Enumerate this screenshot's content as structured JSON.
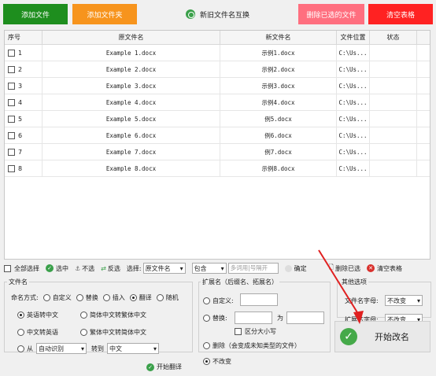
{
  "toolbar": {
    "add_file": "添加文件",
    "add_folder": "添加文件夹",
    "swap_names": "新旧文件名互换",
    "delete_selected_files": "删除已选的文件",
    "clear_table": "清空表格"
  },
  "colors": {
    "add_file_bg": "#1e8e1e",
    "add_folder_bg": "#f7941d",
    "delete_bg": "#ff6f7f",
    "clear_bg": "#ff2222"
  },
  "table": {
    "headers": [
      "序号",
      "原文件名",
      "新文件名",
      "文件位置",
      "状态"
    ],
    "rows": [
      {
        "idx": "1",
        "orig": "Example 1.docx",
        "new": "示例1.docx",
        "loc": "C:\\Us...",
        "status": ""
      },
      {
        "idx": "2",
        "orig": "Example 2.docx",
        "new": "示例2.docx",
        "loc": "C:\\Us...",
        "status": ""
      },
      {
        "idx": "3",
        "orig": "Example 3.docx",
        "new": "示例3.docx",
        "loc": "C:\\Us...",
        "status": ""
      },
      {
        "idx": "4",
        "orig": "Example 4.docx",
        "new": "示例4.docx",
        "loc": "C:\\Us...",
        "status": ""
      },
      {
        "idx": "5",
        "orig": "Example 5.docx",
        "new": "例5.docx",
        "loc": "C:\\Us...",
        "status": ""
      },
      {
        "idx": "6",
        "orig": "Example 6.docx",
        "new": "例6.docx",
        "loc": "C:\\Us...",
        "status": ""
      },
      {
        "idx": "7",
        "orig": "Example 7.docx",
        "new": "例7.docx",
        "loc": "C:\\Us...",
        "status": ""
      },
      {
        "idx": "8",
        "orig": "Example 8.docx",
        "new": "示例8.docx",
        "loc": "C:\\Us...",
        "status": ""
      }
    ]
  },
  "selection_bar": {
    "select_all": "全部选择",
    "select": "选中",
    "unselect": "不选",
    "invert": "反选",
    "choose_label": "选择:",
    "field_value": "原文件名",
    "match_value": "包含",
    "keyword_placeholder": "多词用|号隔开",
    "confirm": "确定",
    "delete_selected": "删除已选",
    "clear_table": "清空表格"
  },
  "filename_panel": {
    "title": "文件名",
    "naming_label": "命名方式:",
    "naming_options": [
      "自定义",
      "替换",
      "插入",
      "翻译",
      "随机"
    ],
    "translate_options": [
      "英语转中文",
      "简体中文转繁体中文",
      "中文转英语",
      "繁体中文转简体中文"
    ],
    "from_label": "从",
    "from_value": "自动识别",
    "to_label": "转到",
    "to_value": "中文",
    "start_translate": "开始翻译"
  },
  "extension_panel": {
    "title": "扩展名（后缀名、拓展名）",
    "custom": "自定义:",
    "replace": "替换:",
    "replace_to": "为",
    "case_sensitive": "区分大小写",
    "delete": "删除（会变成未知类型的文件）",
    "unchanged": "不改变"
  },
  "other_panel": {
    "title": "其他选项",
    "filename_case_label": "文件名字母:",
    "filename_case_value": "不改变",
    "ext_case_label": "扩展名字母:",
    "ext_case_value": "不改变"
  },
  "start_button": "开始改名"
}
